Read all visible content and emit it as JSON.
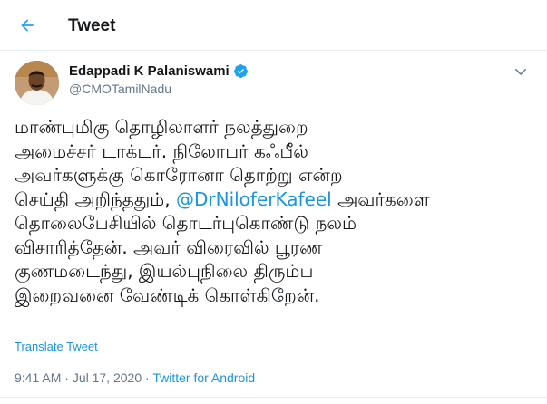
{
  "header": {
    "title": "Tweet",
    "back_icon": "arrow-left-icon"
  },
  "author": {
    "display_name": "Edappadi K Palaniswami",
    "handle": "@CMOTamilNadu",
    "verified": true
  },
  "tweet": {
    "lines": [
      "மாண்புமிகு தொழிலாளர் நலத்துறை",
      "அமைச்சர் டாக்டர். நிலோபர் கஃபீல்",
      "அவர்களுக்கு கொரோனா தொற்று என்ற",
      "செய்தி அறிந்ததும்,",
      "தொலைபேசியில் தொடர்புகொண்டு நலம்",
      "விசாரித்தேன். அவர் விரைவில் பூரண",
      "குணமடைந்து, இயல்புநிலை திரும்ப",
      "இறைவனை வேண்டிக் கொள்கிறேன்."
    ],
    "mention": "@DrNiloferKafeel",
    "line4_after": "அவர்களை"
  },
  "translate_label": "Translate Tweet",
  "meta": {
    "time": "9:41 AM",
    "separator": "·",
    "date": "Jul 17, 2020",
    "source": "Twitter for Android"
  },
  "colors": {
    "accent": "#1b95e0",
    "text": "#14171a",
    "secondary": "#657786",
    "border": "#e6ecf0"
  }
}
